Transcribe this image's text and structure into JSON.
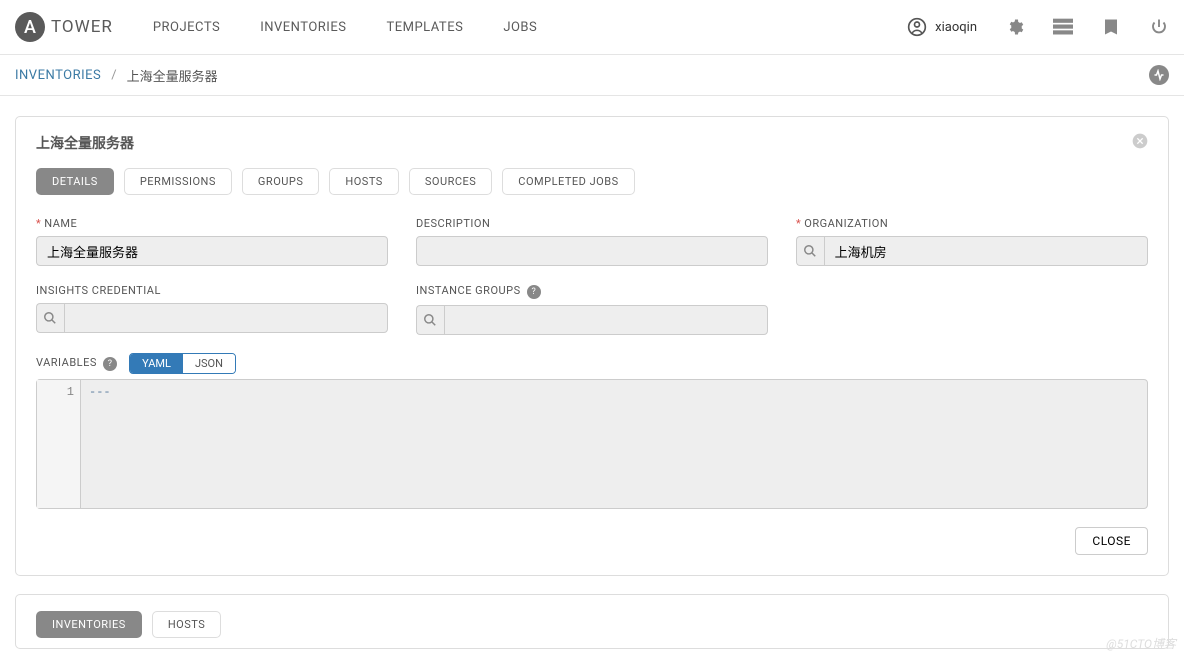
{
  "brand": {
    "logo_letter": "A",
    "name": "TOWER"
  },
  "nav": {
    "links": [
      "PROJECTS",
      "INVENTORIES",
      "TEMPLATES",
      "JOBS"
    ],
    "username": "xiaoqin"
  },
  "breadcrumb": {
    "section": "INVENTORIES",
    "sep": "/",
    "current": "上海全量服务器"
  },
  "card": {
    "title": "上海全量服务器",
    "tabs": [
      "DETAILS",
      "PERMISSIONS",
      "GROUPS",
      "HOSTS",
      "SOURCES",
      "COMPLETED JOBS"
    ],
    "labels": {
      "name": "NAME",
      "description": "DESCRIPTION",
      "organization": "ORGANIZATION",
      "insights": "INSIGHTS CREDENTIAL",
      "instance_groups": "INSTANCE GROUPS",
      "variables": "VARIABLES"
    },
    "values": {
      "name": "上海全量服务器",
      "description": "",
      "organization": "上海机房",
      "insights": "",
      "instance_groups": ""
    },
    "toggle": {
      "yaml": "YAML",
      "json": "JSON"
    },
    "editor": {
      "line": "1",
      "content": "---"
    },
    "close_btn": "CLOSE"
  },
  "lower_tabs": [
    "INVENTORIES",
    "HOSTS"
  ],
  "watermark": "@51CTO博客"
}
